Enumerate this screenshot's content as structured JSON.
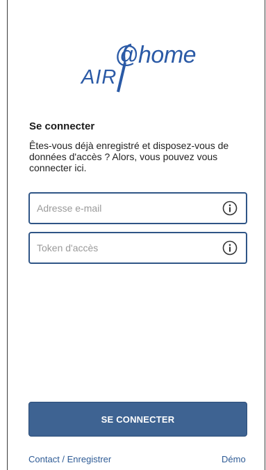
{
  "logo": {
    "home": "@home",
    "air": "AIR"
  },
  "login": {
    "title": "Se connecter",
    "description": "Êtes-vous déjà enregistré et disposez-vous de données d'accès ? Alors, vous pouvez vous connecter ici.",
    "email_placeholder": "Adresse e-mail",
    "token_placeholder": "Token d'accès",
    "submit_label": "SE CONNECTER"
  },
  "footer": {
    "contact_label": "Contact / Enregistrer",
    "demo_label": "Démo"
  },
  "colors": {
    "brand": "#2b5aa6",
    "button": "#3e6392",
    "field_border": "#2f5586",
    "link": "#2e5b95"
  }
}
